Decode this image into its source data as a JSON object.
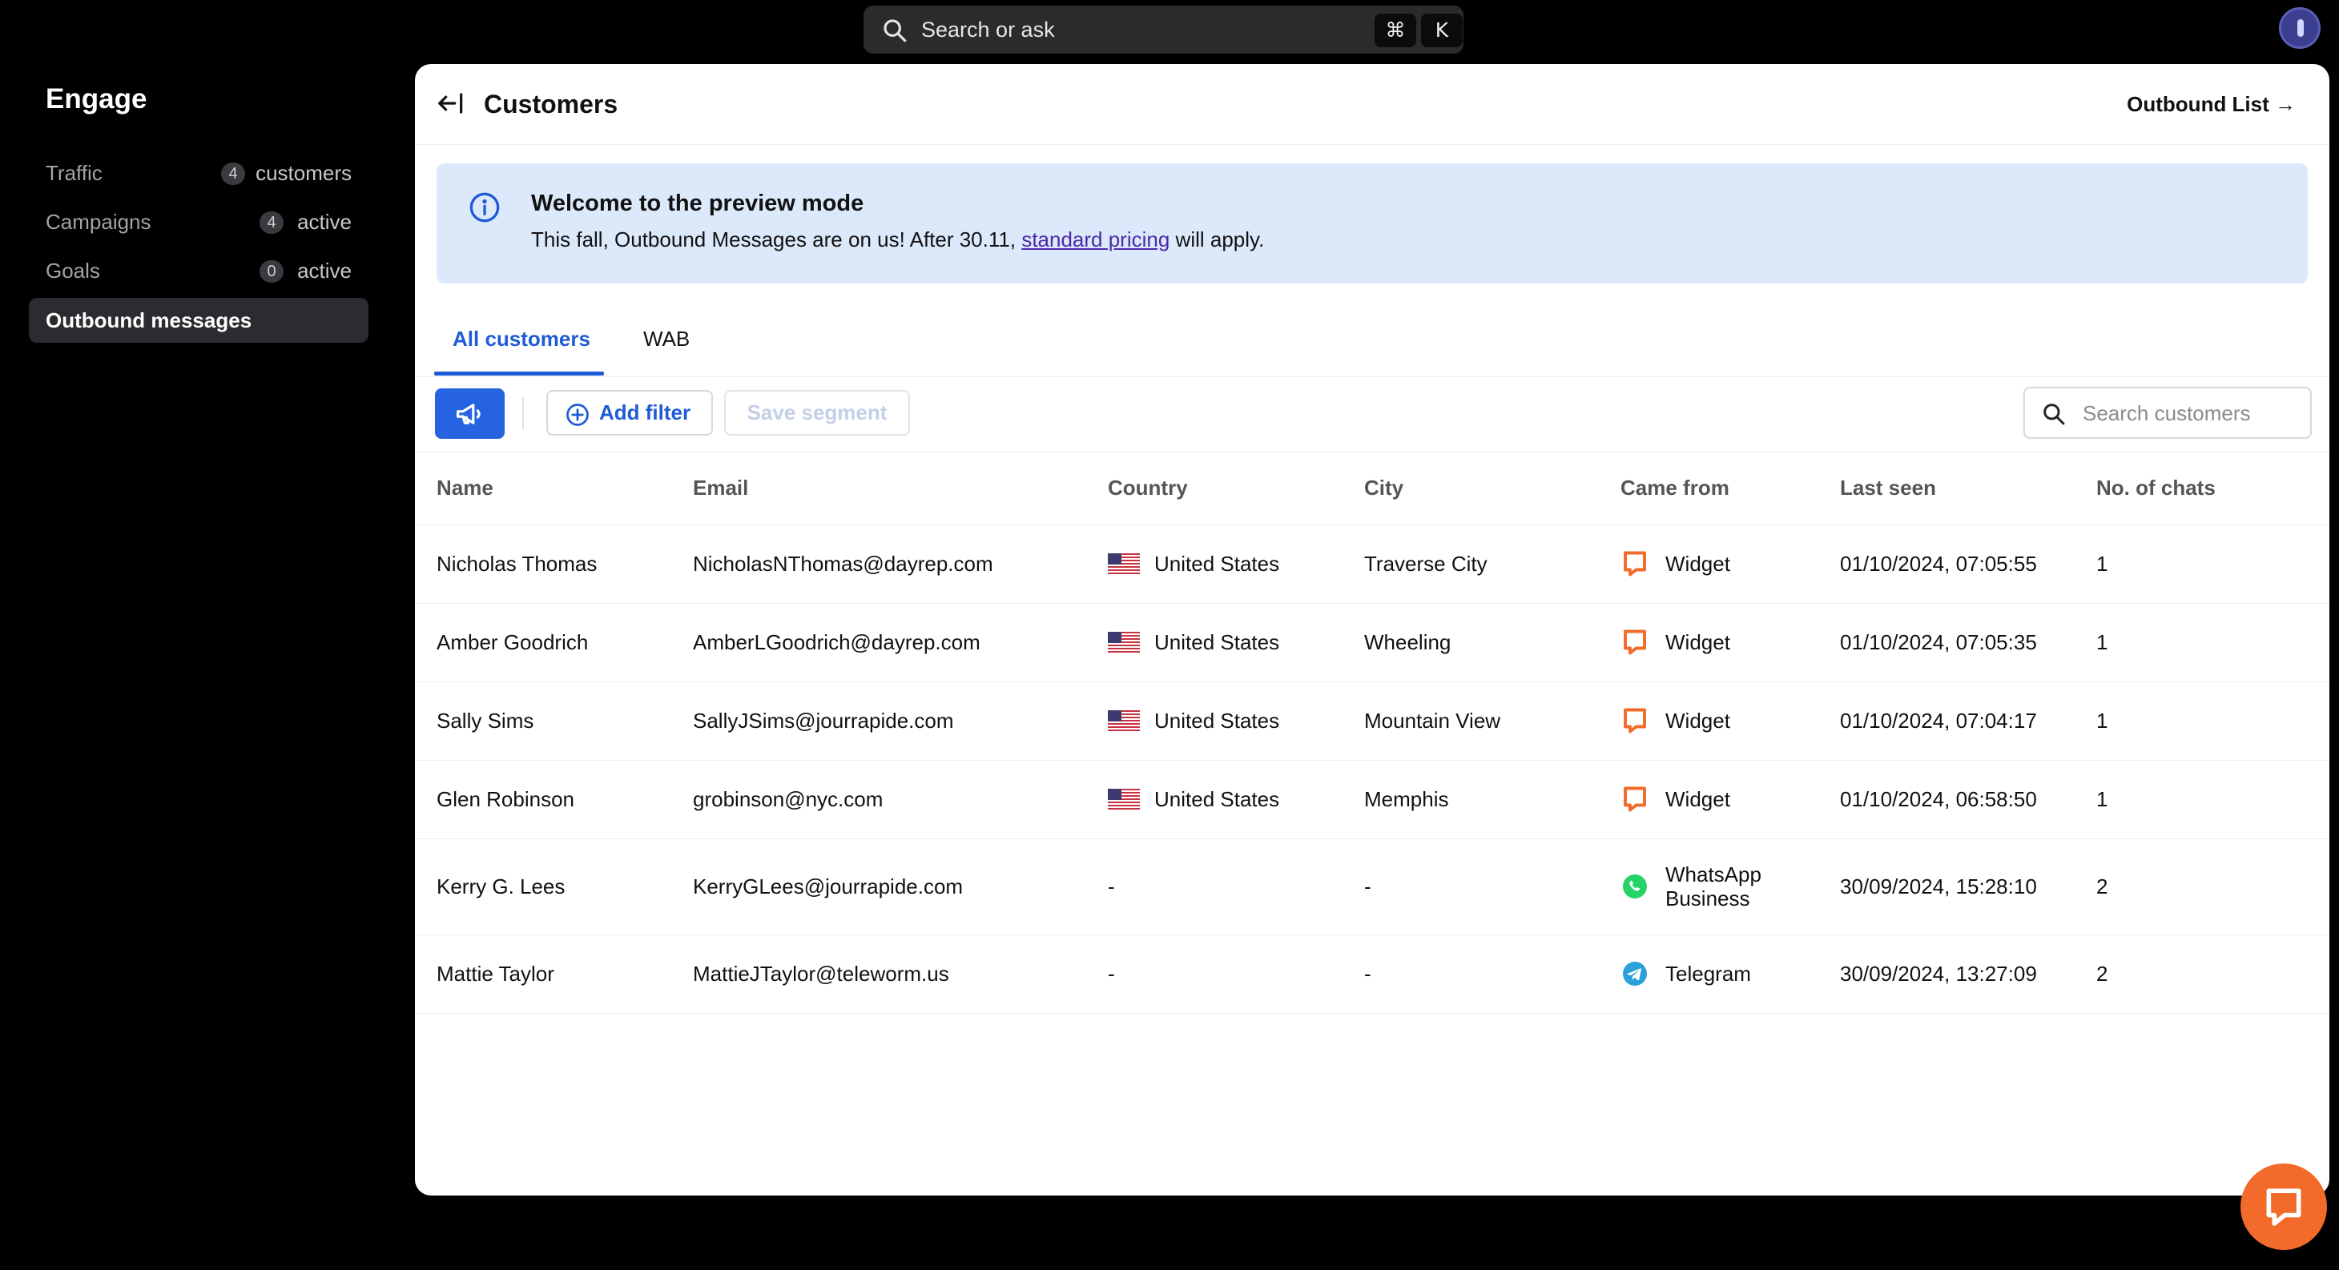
{
  "topbar": {
    "search_placeholder": "Search or ask",
    "shortcut_keys": [
      "⌘",
      "K"
    ]
  },
  "sidebar": {
    "title": "Engage",
    "items": [
      {
        "label": "Traffic",
        "count": "4",
        "suffix": "customers"
      },
      {
        "label": "Campaigns",
        "count": "4",
        "suffix": "active"
      },
      {
        "label": "Goals",
        "count": "0",
        "suffix": "active"
      },
      {
        "label": "Outbound messages",
        "active": true
      }
    ]
  },
  "header": {
    "title": "Customers",
    "outbound_link": "Outbound List →"
  },
  "banner": {
    "title": "Welcome to the preview mode",
    "text_before": "This fall, Outbound Messages are on us! After 30.11, ",
    "link": "standard pricing",
    "text_after": " will apply."
  },
  "tabs": [
    {
      "label": "All customers",
      "active": true
    },
    {
      "label": "WAB"
    }
  ],
  "toolbar": {
    "add_filter": "Add filter",
    "save_segment": "Save segment",
    "search_placeholder": "Search customers"
  },
  "table": {
    "columns": [
      "Name",
      "Email",
      "Country",
      "City",
      "Came from",
      "Last seen",
      "No. of chats"
    ],
    "rows": [
      {
        "name": "Nicholas Thomas",
        "email": "NicholasNThomas@dayrep.com",
        "country": "United States",
        "city": "Traverse City",
        "source": "Widget",
        "source_icon": "widget-icon",
        "last_seen": "01/10/2024, 07:05:55",
        "chats": "1"
      },
      {
        "name": "Amber Goodrich",
        "email": "AmberLGoodrich@dayrep.com",
        "country": "United States",
        "city": "Wheeling",
        "source": "Widget",
        "source_icon": "widget-icon",
        "last_seen": "01/10/2024, 07:05:35",
        "chats": "1"
      },
      {
        "name": "Sally Sims",
        "email": "SallyJSims@jourrapide.com",
        "country": "United States",
        "city": "Mountain View",
        "source": "Widget",
        "source_icon": "widget-icon",
        "last_seen": "01/10/2024, 07:04:17",
        "chats": "1"
      },
      {
        "name": "Glen Robinson",
        "email": "grobinson@nyc.com",
        "country": "United States",
        "city": "Memphis",
        "source": "Widget",
        "source_icon": "widget-icon",
        "last_seen": "01/10/2024, 06:58:50",
        "chats": "1"
      },
      {
        "name": "Kerry G. Lees",
        "email": "KerryGLees@jourrapide.com",
        "country": "-",
        "city": "-",
        "source_line1": "WhatsApp",
        "source_line2": "Business",
        "source_icon": "whatsapp-icon",
        "last_seen": "30/09/2024, 15:28:10",
        "chats": "2"
      },
      {
        "name": "Mattie Taylor",
        "email": "MattieJTaylor@teleworm.us",
        "country": "-",
        "city": "-",
        "source": "Telegram",
        "source_icon": "telegram-icon",
        "last_seen": "30/09/2024, 13:27:09",
        "chats": "2"
      }
    ]
  },
  "colors": {
    "accent": "#1f5bd6",
    "banner_bg": "#dce9fb",
    "widget_orange": "#f26b2a",
    "whatsapp_green": "#25d366",
    "telegram_blue": "#2aa1da"
  }
}
